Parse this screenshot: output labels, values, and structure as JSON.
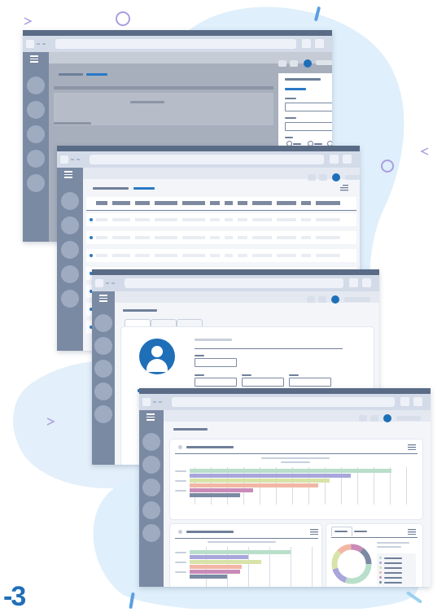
{
  "colors": {
    "blob": "#dfeffb",
    "sidebar": "#7b8aa3",
    "titlebar": "#5a6b86",
    "accent": "#2a79c6",
    "gantt_green": "#b9dfcb",
    "gantt_purple": "#a9a6dc",
    "gantt_yellow": "#d7e3a8",
    "gantt_orange": "#f1b7a4",
    "gantt_pink": "#c98bb8",
    "gantt_gray": "#7b8aa3"
  },
  "icons": {
    "menu": "hamburger-icon",
    "user": "user-avatar-icon",
    "list": "list-icon"
  },
  "corner_mark": "-3"
}
